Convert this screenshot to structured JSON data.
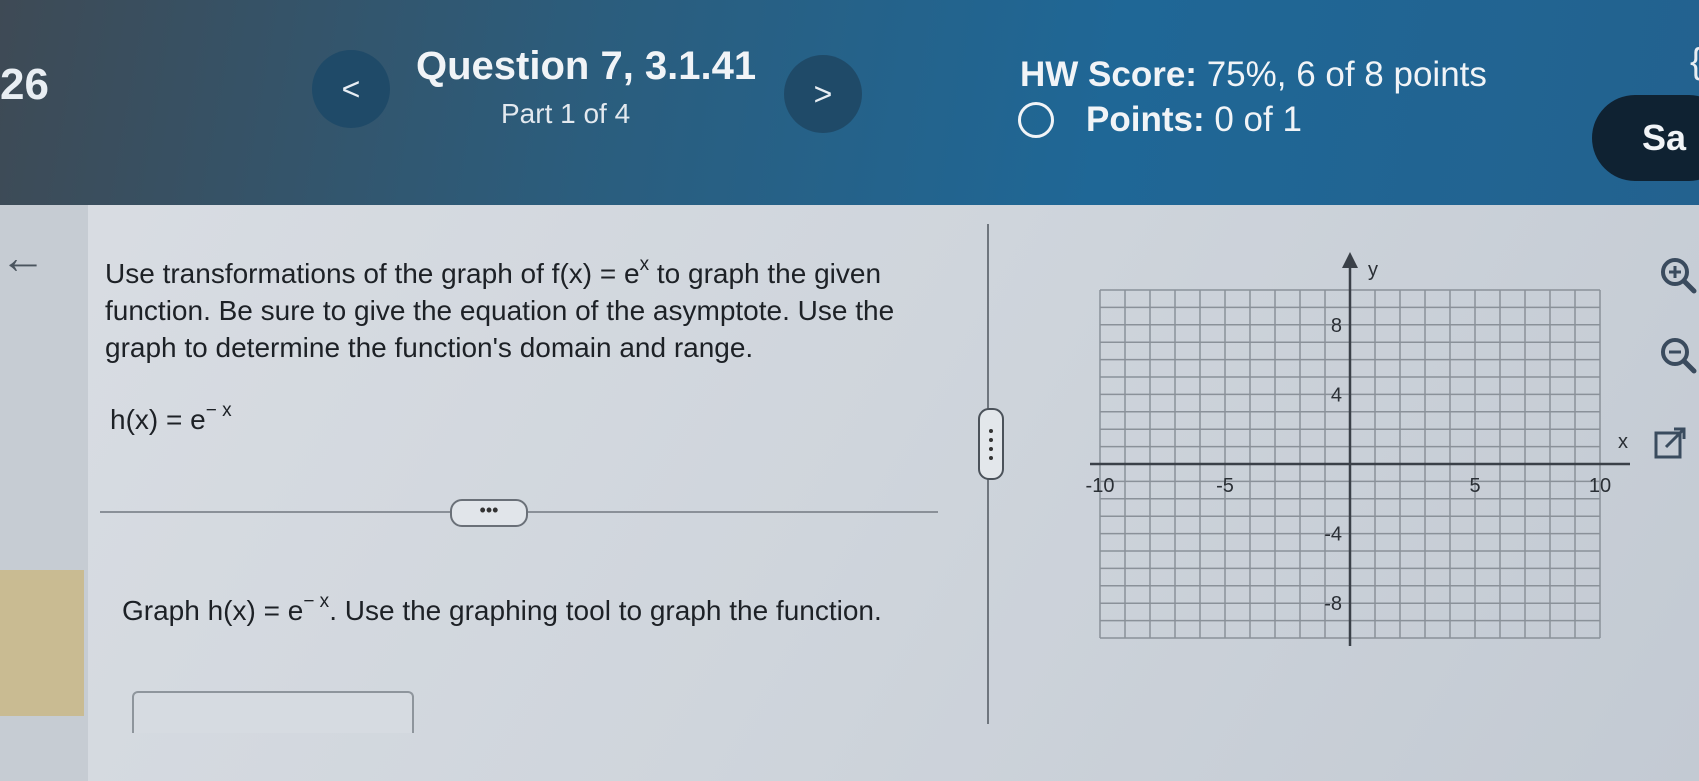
{
  "header": {
    "question_number_fragment": "26",
    "question_title": "Question 7, 3.1.41",
    "part": "Part 1 of 4",
    "hw_score_label": "HW Score:",
    "hw_score_value": "75%, 6 of 8 points",
    "points_label": "Points:",
    "points_value": "0 of 1",
    "save_label": "Sa",
    "prev_glyph": "<",
    "next_glyph": ">"
  },
  "problem": {
    "text_part1": "Use transformations of the graph of f(x) = e",
    "text_sup": "x",
    "text_part2": " to graph the given function. Be sure to give the equation of the asymptote. Use the graph to determine the function's domain and range.",
    "function_base": "h(x) = e",
    "function_exponent": "− x",
    "more_button": "•••"
  },
  "instruction": {
    "part1": "Graph h(x) = e",
    "exponent": "− x",
    "part2": ". Use the graphing tool to graph the function."
  },
  "graph": {
    "x_label": "x",
    "y_label": "y",
    "x_min": -10,
    "x_max": 10,
    "y_min": -10,
    "y_max": 10,
    "x_tick_labels": [
      "-10",
      "-5",
      "5",
      "10"
    ],
    "y_tick_labels": [
      "8",
      "4",
      "-4",
      "-8"
    ],
    "grid": true
  },
  "icons": {
    "zoom_in": "zoom-in-icon",
    "zoom_out": "zoom-out-icon",
    "popout": "popout-icon",
    "back": "back-arrow-icon"
  },
  "colors": {
    "header_dark": "#1f6796",
    "save_button": "#0f2232",
    "grid_line": "#8a9199"
  }
}
